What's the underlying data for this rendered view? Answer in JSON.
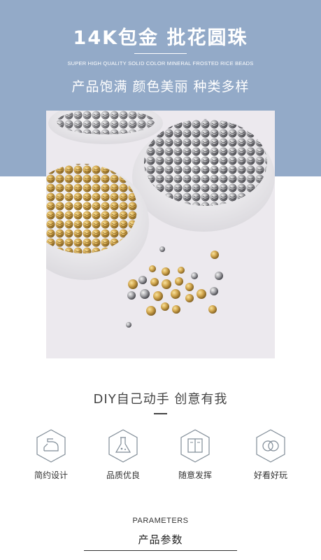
{
  "header": {
    "title": "14K包金 批花圆珠",
    "subtitle_en": "SUPER HIGH QUALITY SOLID COLOR MINERAL FROSTED RICE BEADS",
    "tagline": "产品饱满 颜色美丽 种类多样"
  },
  "colors": {
    "band": "#93aac8",
    "icon_stroke": "#7f8b96"
  },
  "slogan": "DIY自己动手 创意有我",
  "features": [
    {
      "icon": "iron-icon",
      "label": "简约设计"
    },
    {
      "icon": "flask-icon",
      "label": "品质优良"
    },
    {
      "icon": "book-icon",
      "label": "随意发挥"
    },
    {
      "icon": "rings-icon",
      "label": "好看好玩"
    }
  ],
  "parameters": {
    "title_en": "PARAMETERS",
    "title_zh": "产品参数"
  }
}
